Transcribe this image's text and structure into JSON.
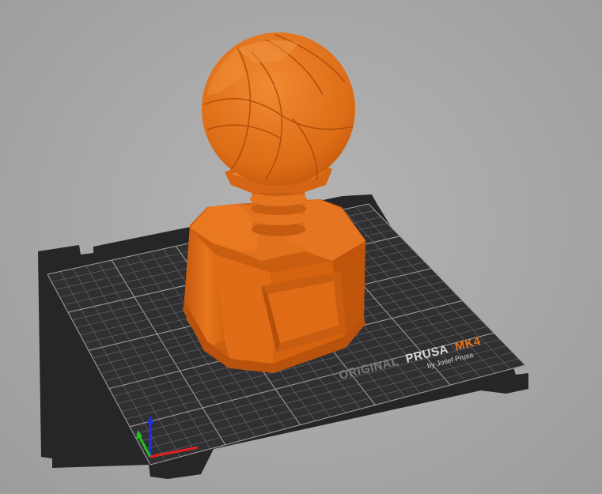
{
  "bed": {
    "brand_prefix": "ORIGINAL",
    "brand_name": "PRUSA",
    "brand_model": "MK4",
    "brand_byline": "by Josef Prusa"
  },
  "colors": {
    "background": "#a8a8a8",
    "bed_surface": "#2f2f31",
    "bed_frame": "#262628",
    "grid_major": "#9a9a9a",
    "grid_minor": "#6a6a6a",
    "model_orange": "#e8741c",
    "brand_accent": "#e8741c",
    "axis_x": "#e02020",
    "axis_y": "#20c020",
    "axis_z": "#2030e0"
  },
  "icons": {
    "axes": "xyz-axes-icon"
  }
}
